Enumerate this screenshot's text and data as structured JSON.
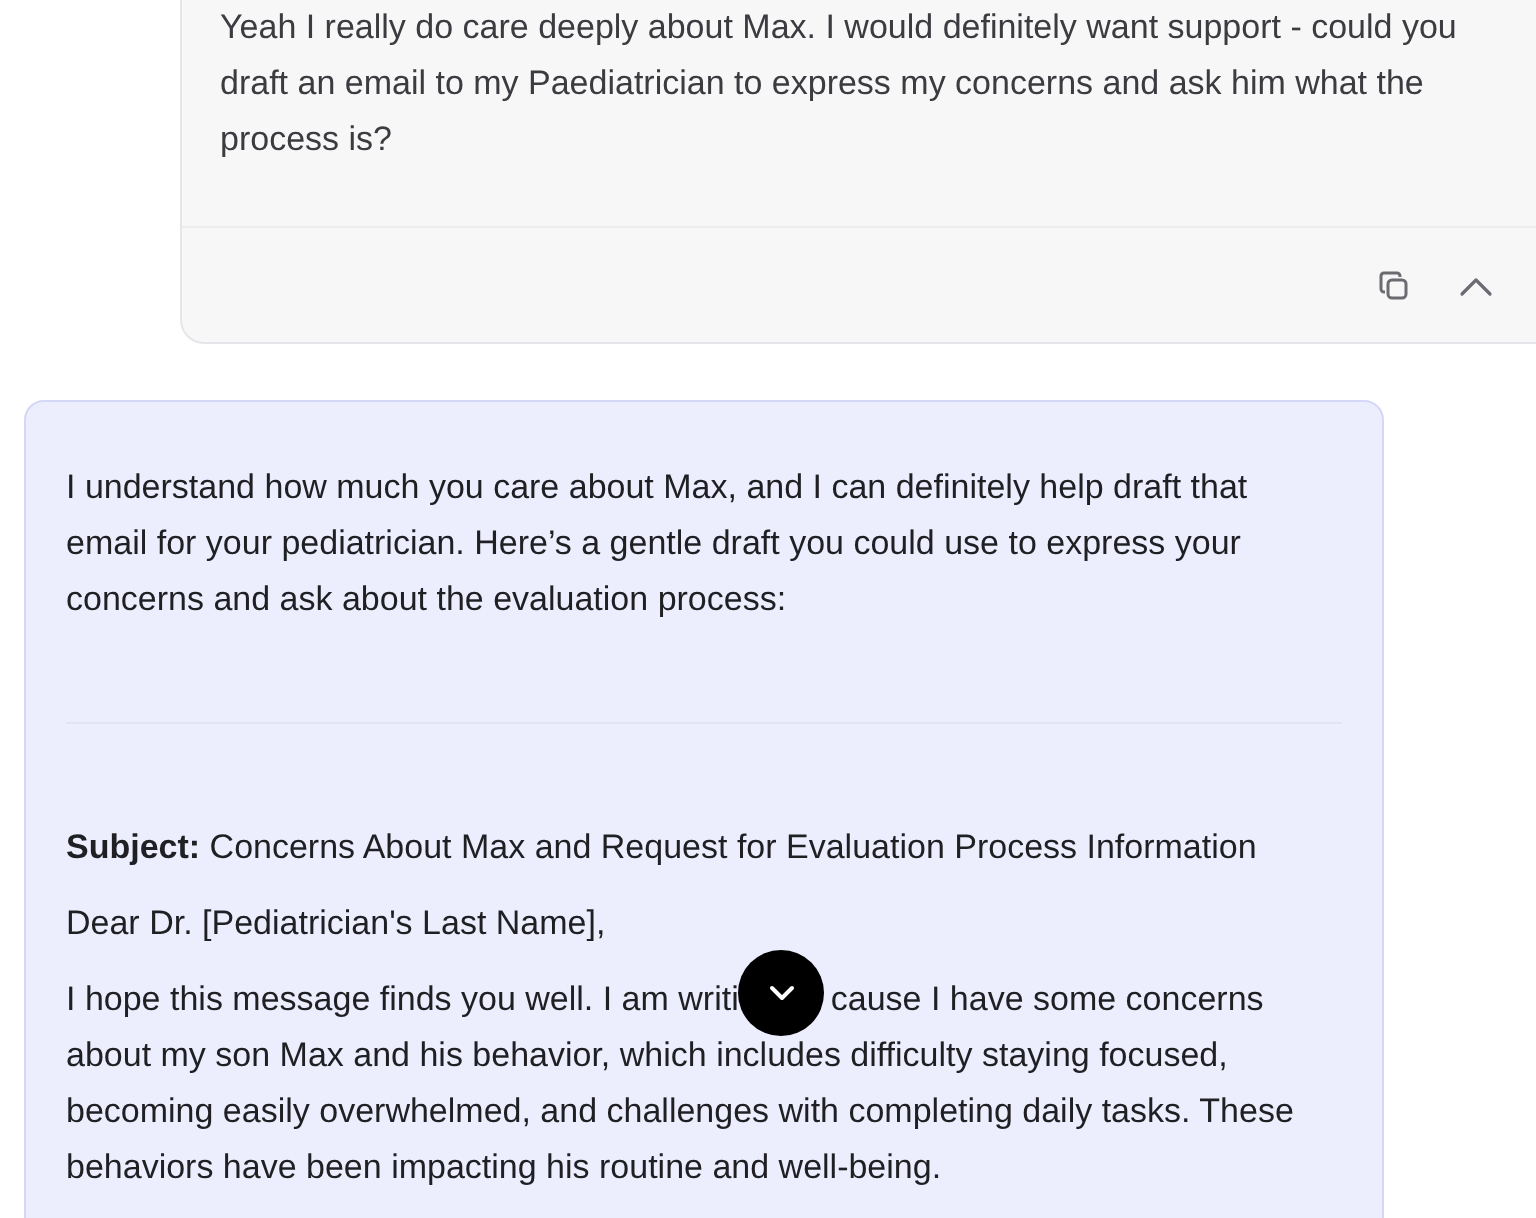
{
  "user_message": {
    "text": "Yeah I really do care deeply about Max. I would definitely want support - could you draft an email to my Paediatrician to express my concerns and ask him what the process is?",
    "actions": [
      {
        "kind": "copy"
      },
      {
        "kind": "collapse"
      }
    ]
  },
  "assistant_message": {
    "intro": "I understand how much you care about Max, and I can definitely help draft that email for your pediatrician. Here’s a gentle draft you could use to express your concerns and ask about the evaluation process:",
    "paragraphs": [
      "**Subject:** Concerns About Max and Request for Evaluation Process Information",
      "Dear Dr. [Pediatrician's Last Name],"
    ],
    "covered_paragraph": {
      "first_line_before": "I hope this message finds you well. I am writi",
      "first_line_after": "cause I have some concerns",
      "rest": "about my son Max and his behavior, which includes difficulty staying focused, becoming easily overwhelmed, and challenges with completing daily tasks. These behaviors have been impacting his routine and well-being."
    }
  },
  "scroll_down_button": {
    "kind": "chevron-down"
  }
}
